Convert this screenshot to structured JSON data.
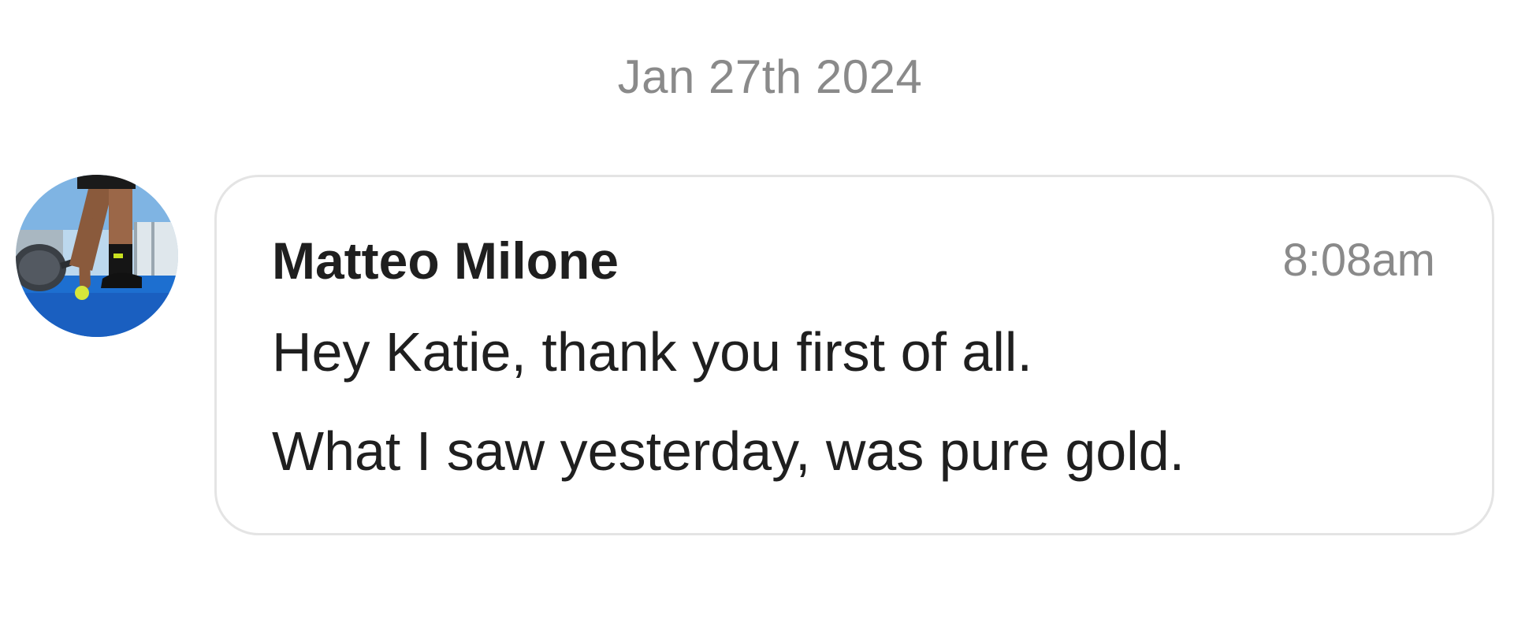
{
  "chat": {
    "date_separator": "Jan 27th 2024",
    "message": {
      "avatar_icon": "user-avatar-photo",
      "sender": "Matteo Milone",
      "time": "8:08am",
      "lines": [
        "Hey Katie, thank you first of all.",
        "What I saw yesterday, was pure gold."
      ]
    }
  },
  "colors": {
    "background": "#ffffff",
    "muted_text": "#8a8a8a",
    "primary_text": "#1f1f1f",
    "bubble_border": "#e4e4e4"
  }
}
